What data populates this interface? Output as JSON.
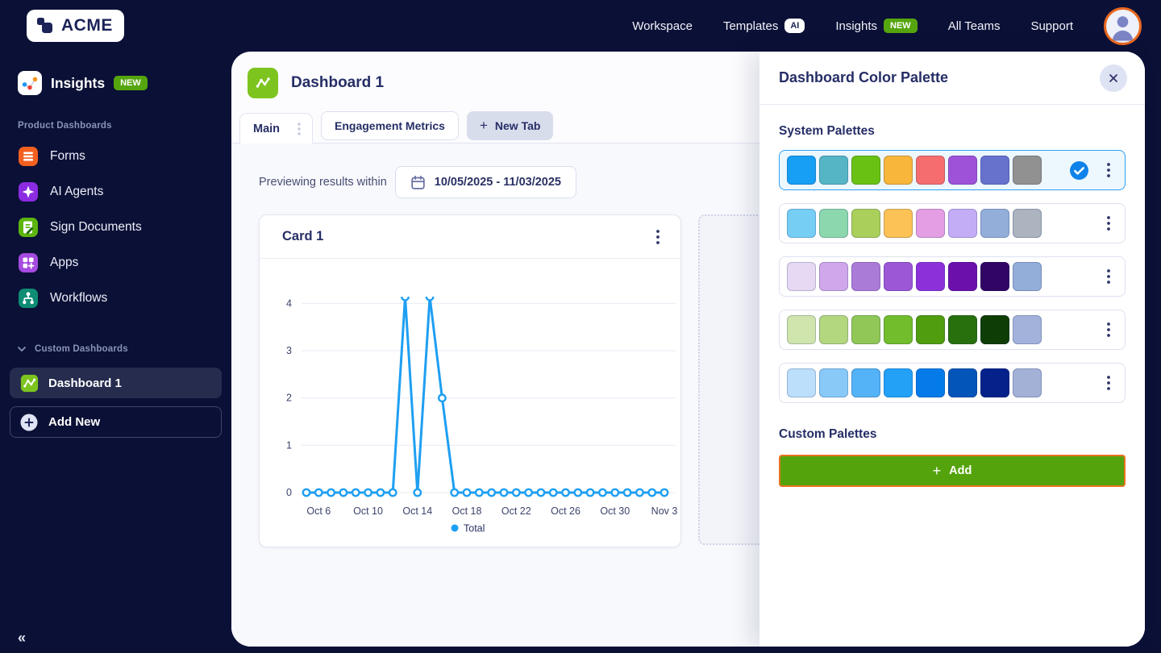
{
  "colors": {
    "navy_bg": "#0b1036",
    "text_navy": "#262e66",
    "accent_blue": "#1e9ff2",
    "accent_green": "#55a50e",
    "accent_orange": "#e8731f"
  },
  "topnav": {
    "logo_text": "ACME",
    "links": [
      {
        "label": "Workspace"
      },
      {
        "label": "Templates",
        "badge": "AI"
      },
      {
        "label": "Insights",
        "badge": "NEW"
      },
      {
        "label": "All Teams"
      },
      {
        "label": "Support"
      }
    ]
  },
  "sidebar": {
    "app_title": "Insights",
    "app_badge": "NEW",
    "section1_label": "Product Dashboards",
    "items": [
      {
        "label": "Forms"
      },
      {
        "label": "AI Agents"
      },
      {
        "label": "Sign Documents"
      },
      {
        "label": "Apps"
      },
      {
        "label": "Workflows"
      }
    ],
    "section2_label": "Custom Dashboards",
    "dashboard_item": "Dashboard 1",
    "add_new_label": "Add New",
    "collapse_glyph": "«"
  },
  "main": {
    "title": "Dashboard 1",
    "tabs": [
      {
        "label": "Main"
      },
      {
        "label": "Engagement Metrics"
      },
      {
        "label": "New Tab",
        "plus": "+"
      }
    ],
    "preview_label": "Previewing results within",
    "date_range": "10/05/2025 - 11/03/2025",
    "card_title": "Card 1"
  },
  "panel": {
    "title": "Dashboard Color Palette",
    "system_heading": "System Palettes",
    "custom_heading": "Custom Palettes",
    "add_label": "Add",
    "add_plus": "+",
    "palettes": [
      {
        "selected": true,
        "colors": [
          "#169ff4",
          "#55b5c5",
          "#69c213",
          "#f8b63a",
          "#f56d6d",
          "#9e52d8",
          "#6672cc",
          "#919191"
        ]
      },
      {
        "selected": false,
        "colors": [
          "#76cef5",
          "#8cd7ae",
          "#aad05b",
          "#fcc255",
          "#e49ee3",
          "#c4adf7",
          "#93aed8",
          "#abb4bf"
        ]
      },
      {
        "selected": false,
        "colors": [
          "#e7d9f4",
          "#cfa7ea",
          "#ab7bd8",
          "#9c57d6",
          "#8c31da",
          "#6c10ac",
          "#310564",
          "#93aed8"
        ]
      },
      {
        "selected": false,
        "colors": [
          "#cfe5ad",
          "#b2d77f",
          "#90c756",
          "#72bd2b",
          "#509d0e",
          "#28700d",
          "#0f3d06",
          "#a3b2da"
        ]
      },
      {
        "selected": false,
        "colors": [
          "#bcdffb",
          "#88c9f8",
          "#54b3f6",
          "#22a1f7",
          "#047be9",
          "#0455b9",
          "#05228b",
          "#a3b1d7"
        ]
      }
    ]
  },
  "chart_data": {
    "type": "line",
    "title": "Card 1",
    "series_name": "Total",
    "line_color": "#1e9ff2",
    "x": [
      "Oct 5",
      "Oct 6",
      "Oct 7",
      "Oct 8",
      "Oct 9",
      "Oct 10",
      "Oct 11",
      "Oct 12",
      "Oct 13",
      "Oct 14",
      "Oct 15",
      "Oct 16",
      "Oct 17",
      "Oct 18",
      "Oct 19",
      "Oct 20",
      "Oct 21",
      "Oct 22",
      "Oct 23",
      "Oct 24",
      "Oct 25",
      "Oct 26",
      "Oct 27",
      "Oct 28",
      "Oct 29",
      "Oct 30",
      "Oct 31",
      "Nov 1",
      "Nov 2",
      "Nov 3"
    ],
    "values": [
      0,
      0,
      0,
      0,
      0,
      0,
      0,
      0,
      4,
      0,
      4,
      2,
      0,
      0,
      0,
      0,
      0,
      0,
      0,
      0,
      0,
      0,
      0,
      0,
      0,
      0,
      0,
      0,
      0,
      0
    ],
    "tick_labels": [
      "Oct 6",
      "Oct 10",
      "Oct 14",
      "Oct 18",
      "Oct 22",
      "Oct 26",
      "Oct 30",
      "Nov 3"
    ],
    "tick_indices": [
      1,
      5,
      9,
      13,
      17,
      21,
      25,
      29
    ],
    "yticks": [
      0,
      1,
      2,
      3,
      4
    ],
    "ylim": [
      0,
      4
    ],
    "grid": true,
    "legend_position": "bottom"
  }
}
